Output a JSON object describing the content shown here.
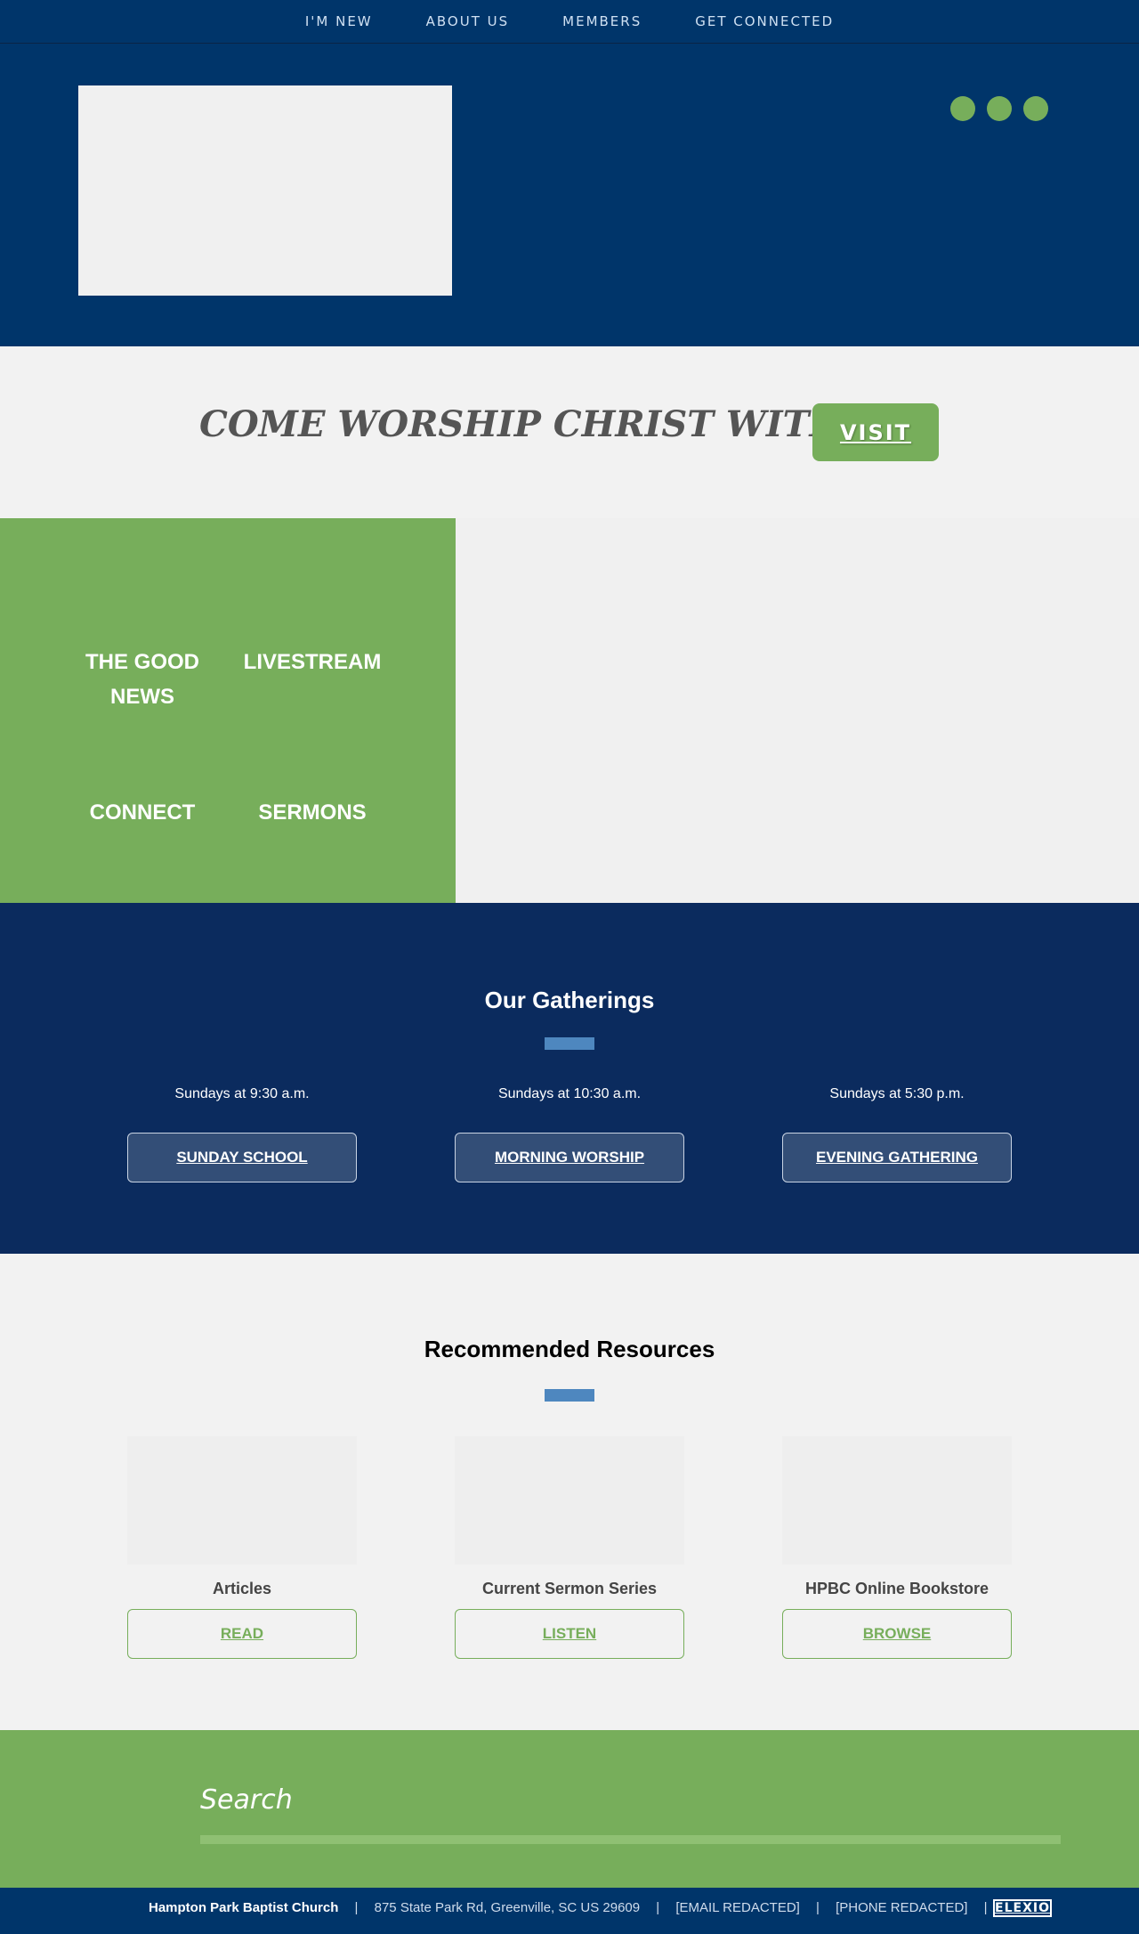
{
  "nav": {
    "items": [
      {
        "label": "I'M NEW"
      },
      {
        "label": "ABOUT US"
      },
      {
        "label": "MEMBERS"
      },
      {
        "label": "GET CONNECTED"
      }
    ]
  },
  "header": {
    "social_icons": [
      "social-icon",
      "social-icon",
      "social-icon"
    ]
  },
  "banner": {
    "title": "COME WORSHIP CHRIST WITH US",
    "visit_label": "VISIT"
  },
  "quick_links": [
    {
      "label": "THE GOOD NEWS"
    },
    {
      "label": "LIVESTREAM"
    },
    {
      "label": "CONNECT"
    },
    {
      "label": "SERMONS"
    }
  ],
  "gatherings": {
    "title": "Our Gatherings",
    "items": [
      {
        "time": "Sundays at 9:30 a.m.",
        "button": "SUNDAY SCHOOL"
      },
      {
        "time": "Sundays at 10:30 a.m.",
        "button": "MORNING WORSHIP"
      },
      {
        "time": "Sundays at 5:30 p.m.",
        "button": "EVENING GATHERING"
      }
    ]
  },
  "resources": {
    "title": "Recommended Resources",
    "items": [
      {
        "title": "Articles",
        "button": "READ"
      },
      {
        "title": "Current Sermon Series",
        "button": "LISTEN"
      },
      {
        "title": "HPBC Online Bookstore",
        "button": "BROWSE"
      }
    ]
  },
  "search": {
    "placeholder": "Search"
  },
  "footer": {
    "church_name": "Hampton Park Baptist Church",
    "address": "875 State Park Rd, Greenville, SC US 29609",
    "email": "[EMAIL REDACTED]",
    "phone": "[PHONE REDACTED]",
    "separator": "|",
    "brand": "ELEXIO"
  },
  "colors": {
    "navy": "#00356a",
    "dark_navy": "#0b2b5e",
    "green": "#77ae5b",
    "accent_blue": "#4e87bf",
    "light_bg": "#f2f2f2"
  }
}
